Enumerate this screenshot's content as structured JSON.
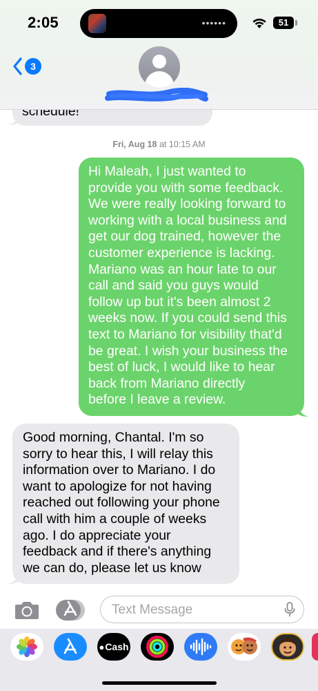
{
  "status_bar": {
    "time": "2:05",
    "battery": "51"
  },
  "header": {
    "back_badge_count": "3"
  },
  "messages": {
    "previous_fragment": "schedule!",
    "timestamp_day": "Fri, Aug 18",
    "timestamp_time": " at 10:15 AM",
    "sent_lines": [
      "Hi Maleah, I just wanted to",
      "provide you with some feedback.",
      "We were really looking forward to",
      "working with a local business and",
      "get our dog trained, however the",
      "customer experience is lacking.",
      "Mariano was an hour late to our",
      "call and said you guys would",
      "follow up but it's been almost 2",
      "weeks now. If you could send this",
      "text to Mariano for visibility that'd",
      "be great. I wish your business the",
      "best of luck, I would like to hear",
      "back from Mariano directly",
      "before I leave a review."
    ],
    "received_lines": [
      "Good morning, Chantal. I'm so",
      "sorry to hear this, I will relay this",
      "information over to Mariano. I do",
      "want to apologize for not having",
      "reached out following your phone",
      "call with him a couple of weeks",
      "ago. I do appreciate your",
      "feedback and if there's anything",
      "we can do, please let us know"
    ]
  },
  "input": {
    "placeholder": "Text Message"
  },
  "app_strip": {
    "cash_label": "Cash",
    "apps": [
      "photos-app",
      "app-store-app",
      "apple-cash-app",
      "fitness-app",
      "audio-message-app",
      "memoji-stickers-app",
      "memoji-app"
    ]
  },
  "colors": {
    "sent_bubble": "#6bd36b",
    "received_bubble": "#e9e9eb",
    "accent_blue": "#0a7aff"
  }
}
